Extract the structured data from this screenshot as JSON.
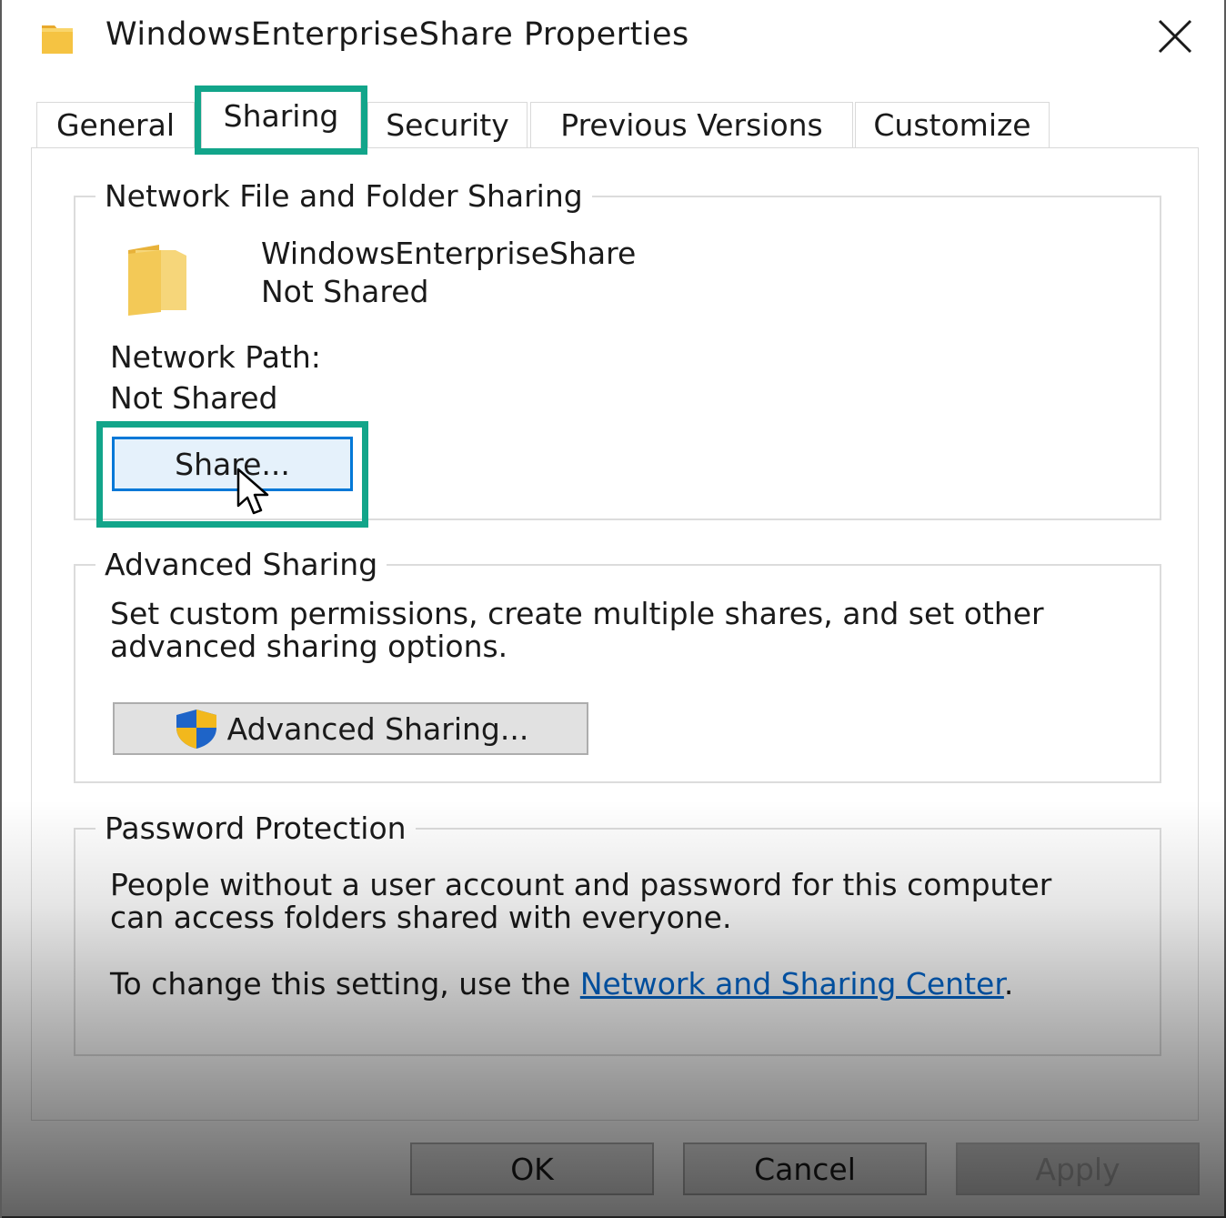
{
  "window": {
    "title": "WindowsEnterpriseShare Properties",
    "close_icon": "close-icon"
  },
  "tabs": [
    {
      "label": "General",
      "active": false
    },
    {
      "label": "Sharing",
      "active": true
    },
    {
      "label": "Security",
      "active": false
    },
    {
      "label": "Previous Versions",
      "active": false
    },
    {
      "label": "Customize",
      "active": false
    }
  ],
  "network_sharing": {
    "legend": "Network File and Folder Sharing",
    "folder_name": "WindowsEnterpriseShare",
    "folder_status": "Not Shared",
    "path_label": "Network Path:",
    "path_value": "Not Shared",
    "share_button": "Share..."
  },
  "advanced_sharing": {
    "legend": "Advanced Sharing",
    "description_line1": "Set custom permissions, create multiple shares, and set other",
    "description_line2": "advanced sharing options.",
    "button": "Advanced Sharing..."
  },
  "password_protection": {
    "legend": "Password Protection",
    "description_line1": "People without a user account and password for this computer",
    "description_line2": "can access folders shared with everyone.",
    "change_prefix": "To change this setting, use the ",
    "link": "Network and Sharing Center",
    "change_suffix": "."
  },
  "footer": {
    "ok": "OK",
    "cancel": "Cancel",
    "apply": "Apply"
  },
  "colors": {
    "highlight": "#12a58a",
    "link": "#0066cc",
    "focus_border": "#0078d7",
    "folder_yellow": "#f5c342"
  },
  "icons": [
    "folder-icon",
    "close-icon",
    "uac-shield-icon",
    "mouse-cursor-icon"
  ]
}
